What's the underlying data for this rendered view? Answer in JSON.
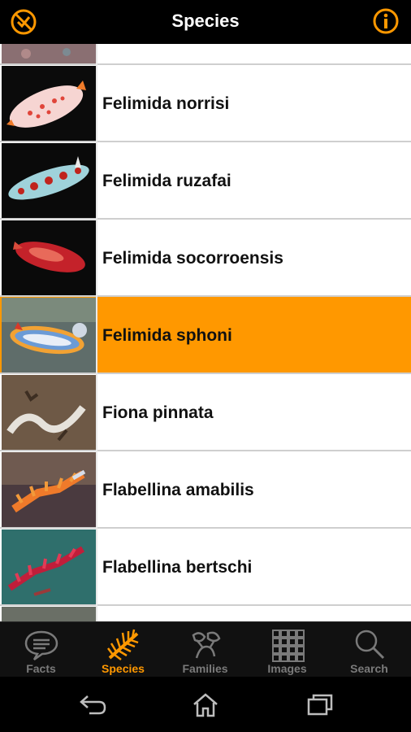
{
  "header": {
    "title": "Species",
    "left_icon": "no-filter-icon",
    "right_icon": "info-icon"
  },
  "species": [
    {
      "name": "Felimida norrisi",
      "selected": false
    },
    {
      "name": "Felimida ruzafai",
      "selected": false
    },
    {
      "name": "Felimida socorroensis",
      "selected": false
    },
    {
      "name": "Felimida sphoni",
      "selected": true
    },
    {
      "name": "Fiona pinnata",
      "selected": false
    },
    {
      "name": "Flabellina amabilis",
      "selected": false
    },
    {
      "name": "Flabellina bertschi",
      "selected": false
    }
  ],
  "tabs": [
    {
      "label": "Facts",
      "icon": "speech-bubble-icon",
      "active": false
    },
    {
      "label": "Species",
      "icon": "nudibranch-icon",
      "active": true
    },
    {
      "label": "Families",
      "icon": "family-tree-icon",
      "active": false
    },
    {
      "label": "Images",
      "icon": "grid-icon",
      "active": false
    },
    {
      "label": "Search",
      "icon": "search-icon",
      "active": false
    }
  ],
  "colors": {
    "accent": "#ff9800",
    "inactive_tab": "#7a7a7a",
    "bar_background": "#000000"
  }
}
